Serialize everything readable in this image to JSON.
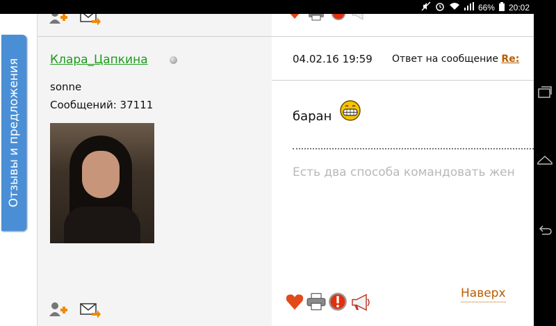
{
  "status_bar": {
    "battery": "66%",
    "time": "20:02",
    "icons": [
      "mute-icon",
      "alarm-icon",
      "wifi-icon",
      "signal-icon",
      "battery-icon"
    ]
  },
  "nav_bar": {
    "buttons": [
      "recent-apps-icon",
      "home-icon",
      "back-icon"
    ]
  },
  "sidebar_tab": {
    "label": "Отзывы и предложения"
  },
  "post": {
    "author": {
      "name": "Клара_Цапкина",
      "online_status": "offline",
      "title": "sonne",
      "post_count": "Сообщений: 37111"
    },
    "date": "04.02.16 19:59",
    "reply_label": "Ответ на сообщение",
    "reply_link": "Re:",
    "message": "баран",
    "emoticon": "grin-smiley-icon",
    "signature": "Есть два способа командовать жен",
    "action_icons": [
      "heart-icon",
      "print-icon",
      "report-icon",
      "megaphone-icon"
    ],
    "to_top": "Наверх"
  },
  "colors": {
    "accent_link": "#1a9b1a",
    "orange_link": "#b85c00",
    "tab_blue": "#4a8fd6"
  }
}
